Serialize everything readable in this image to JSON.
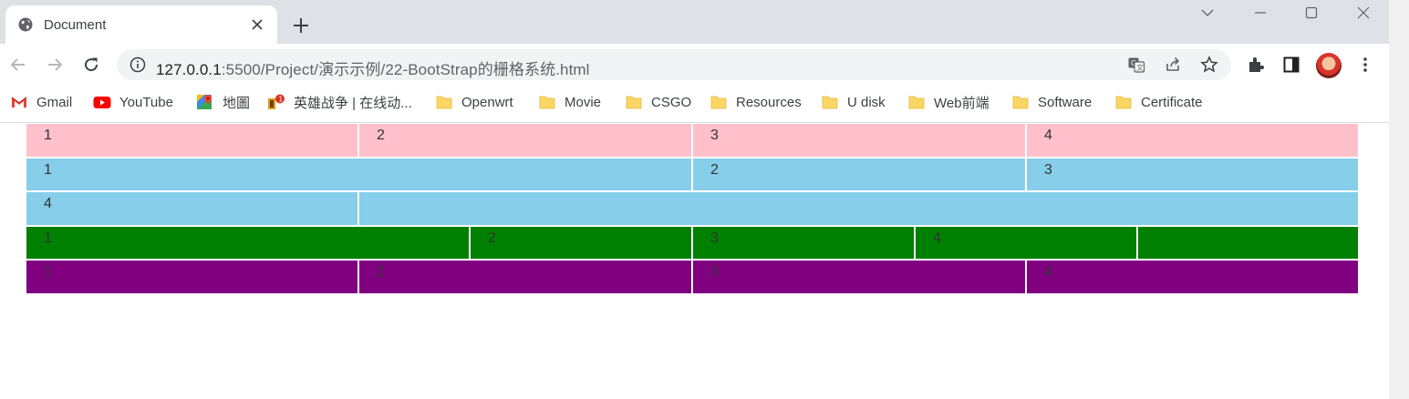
{
  "tab": {
    "title": "Document",
    "favicon": "globe-icon",
    "close_icon": "close-icon",
    "new_tab_icon": "plus-icon"
  },
  "window_controls": [
    "chevron-down-icon",
    "minimize-icon",
    "maximize-icon",
    "close-window-icon"
  ],
  "toolbar": {
    "back_icon": "back-arrow-icon",
    "forward_icon": "forward-arrow-icon",
    "reload_icon": "reload-icon",
    "url_host": "127.0.0.1",
    "url_path": ":5500/Project/演示示例/22-BootStrap的栅格系统.html",
    "omnibox_icons": [
      "translate-icon",
      "share-icon",
      "star-icon"
    ],
    "right_icons": [
      "extensions-icon",
      "side-panel-icon",
      "profile-avatar",
      "menu-icon"
    ]
  },
  "bookmarks": [
    {
      "label": "Gmail",
      "icon": "gmail-icon"
    },
    {
      "label": "YouTube",
      "icon": "youtube-icon"
    },
    {
      "label": "地圖",
      "icon": "maps-icon"
    },
    {
      "label": "英雄战争 | 在线动...",
      "icon": "game-icon"
    },
    {
      "label": "Openwrt",
      "icon": "folder-icon"
    },
    {
      "label": "Movie",
      "icon": "folder-icon"
    },
    {
      "label": "CSGO",
      "icon": "folder-icon"
    },
    {
      "label": "Resources",
      "icon": "folder-icon"
    },
    {
      "label": "U disk",
      "icon": "folder-icon"
    },
    {
      "label": "Web前端",
      "icon": "folder-icon"
    },
    {
      "label": "Software",
      "icon": "folder-icon"
    },
    {
      "label": "Certificate",
      "icon": "folder-icon"
    }
  ],
  "colors": {
    "pink": "#ffc0cb",
    "skyblue": "#87ceeb",
    "green": "#008000",
    "purple": "#800080"
  },
  "grid": {
    "row1": [
      "1",
      "2",
      "3",
      "4"
    ],
    "row2": [
      "1",
      "2",
      "3",
      "4",
      ""
    ],
    "row3": [
      "1",
      "2",
      "3",
      "4",
      ""
    ],
    "row4": [
      "1",
      "2",
      "3",
      "4"
    ]
  }
}
